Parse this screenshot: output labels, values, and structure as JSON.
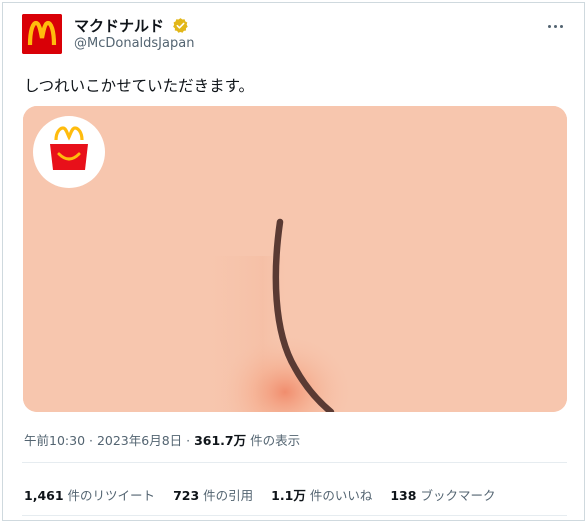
{
  "account": {
    "display_name": "マクドナルド",
    "handle": "@McDonaldsJapan"
  },
  "tweet": {
    "text": "しつれいこかせていただきます。"
  },
  "meta": {
    "time": "午前10:30",
    "separator": " · ",
    "date": "2023年6月8日",
    "separator2": " · ",
    "views_count": "361.7万",
    "views_label": " 件の表示"
  },
  "stats": {
    "retweets_count": "1,461",
    "retweets_label": "件のリツイート",
    "quotes_count": "723",
    "quotes_label": "件の引用",
    "likes_count": "1.1万",
    "likes_label": "件のいいね",
    "bookmarks_count": "138",
    "bookmarks_label": "ブックマーク"
  },
  "icons": {
    "avatar": "mcdonalds-logo",
    "verified": "gold-verified-badge-icon",
    "more": "more-dots-icon",
    "happy_meal": "happy-meal-box-icon"
  },
  "colors": {
    "brand_red": "#d90007",
    "brand_yellow": "#ffbc0d",
    "skin_background": "#f7c6ae",
    "crack_line": "#5a3a33",
    "verified_gold": "#e2b719",
    "secondary_text": "#536471"
  }
}
